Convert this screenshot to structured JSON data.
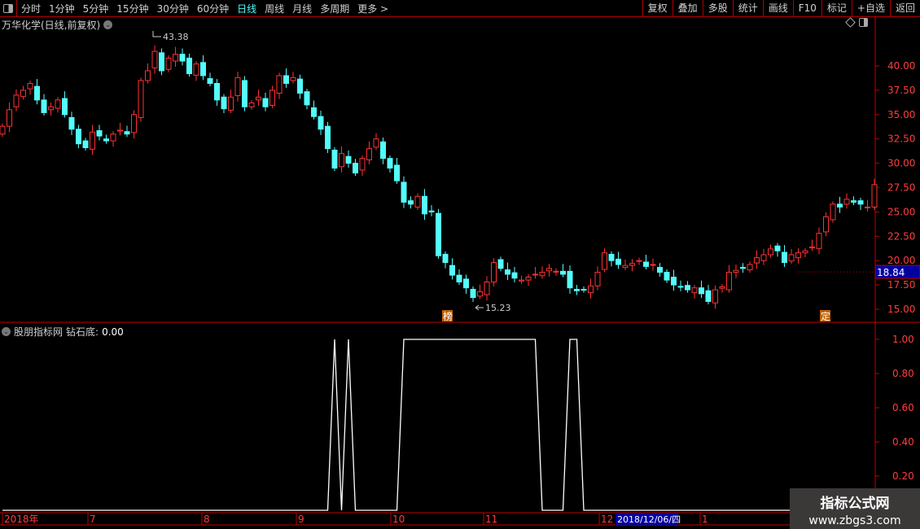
{
  "toolbar": {
    "periods": [
      "分时",
      "1分钟",
      "5分钟",
      "15分钟",
      "30分钟",
      "60分钟",
      "日线",
      "周线",
      "月线",
      "多周期",
      "更多 >"
    ],
    "active_period": "日线",
    "buttons": [
      "复权",
      "叠加",
      "多股",
      "统计",
      "画线",
      "F10",
      "标记",
      "+自选",
      "返回"
    ]
  },
  "main_panel": {
    "title": "万华化学(日线,前复权)",
    "high_label": "43.38",
    "low_label": "15.23",
    "current_price_label": "18.84",
    "markers": [
      "榜",
      "定"
    ]
  },
  "indicator_panel": {
    "name": "股朋指标网",
    "series_label": "钻石底:",
    "value": "0.00"
  },
  "colors": {
    "up": "#ff3232",
    "down": "#54fcfc",
    "axis": "#c00000",
    "axis_text": "#ff3c3c",
    "indicator": "#ffffff",
    "highlight_bg": "#0000a0"
  },
  "date_axis": {
    "labels": [
      "2018年",
      "7",
      "8",
      "9",
      "10",
      "11",
      "12",
      "1"
    ],
    "highlight": "2018/12/06/四"
  },
  "watermark": {
    "line1": "指标公式网",
    "line2": "www.zbgs3.com"
  },
  "chart_data": [
    {
      "type": "candlestick",
      "y_ticks": [
        "40.00",
        "37.50",
        "35.00",
        "32.50",
        "30.00",
        "27.50",
        "25.00",
        "22.50",
        "20.00",
        "17.50",
        "15.00"
      ],
      "ylim": [
        15,
        40
      ],
      "closes": [
        33.8,
        35.5,
        37.0,
        37.5,
        38.2,
        36.5,
        35.2,
        35.8,
        36.5,
        35.0,
        33.5,
        32.0,
        31.6,
        33.2,
        32.8,
        32.3,
        33.0,
        33.4,
        33.0,
        35.0,
        38.5,
        39.5,
        41.5,
        39.5,
        40.8,
        41.2,
        40.5,
        39.2,
        40.2,
        39.0,
        38.2,
        36.5,
        35.6,
        36.8,
        38.8,
        35.8,
        36.2,
        36.8,
        35.8,
        37.5,
        39.0,
        38.2,
        38.8,
        37.2,
        36.0,
        34.8,
        33.5,
        31.5,
        29.5,
        31.0,
        30.0,
        29.0,
        30.5,
        31.5,
        32.5,
        30.5,
        29.5,
        28.2,
        26.0,
        25.8,
        26.6,
        24.8,
        25.0,
        20.5,
        19.8,
        18.5,
        17.8,
        17.2,
        16.2,
        16.8,
        17.8,
        19.8,
        19.2,
        18.6,
        18.2,
        18.0,
        18.3,
        18.6,
        18.8,
        19.2,
        18.9,
        18.6,
        17.2,
        16.9,
        17.0,
        17.4,
        18.8,
        20.8,
        20.0,
        19.6,
        19.5,
        19.7,
        20.0,
        19.4,
        19.6,
        18.8,
        18.0,
        17.5,
        17.3,
        17.0,
        17.2,
        16.6,
        15.8,
        17.0,
        17.3,
        18.8,
        19.0,
        19.2,
        19.6,
        20.3,
        20.6,
        21.2,
        21.0,
        19.8,
        20.6,
        20.8,
        21.0,
        21.4,
        22.8,
        24.5,
        25.8,
        25.5,
        26.3,
        26.0,
        25.8,
        25.5,
        27.8
      ],
      "high": 43.38,
      "low": 15.23,
      "last": 18.84
    },
    {
      "type": "line",
      "series_name": "钻石底",
      "y_ticks": [
        "1.00",
        "0.80",
        "0.60",
        "0.40",
        "0.20"
      ],
      "ylim": [
        0,
        1
      ],
      "one_indices": [
        48,
        50,
        58,
        59,
        60,
        61,
        62,
        63,
        64,
        65,
        66,
        67,
        68,
        69,
        70,
        71,
        72,
        73,
        74,
        75,
        76,
        77,
        82,
        83
      ]
    }
  ]
}
